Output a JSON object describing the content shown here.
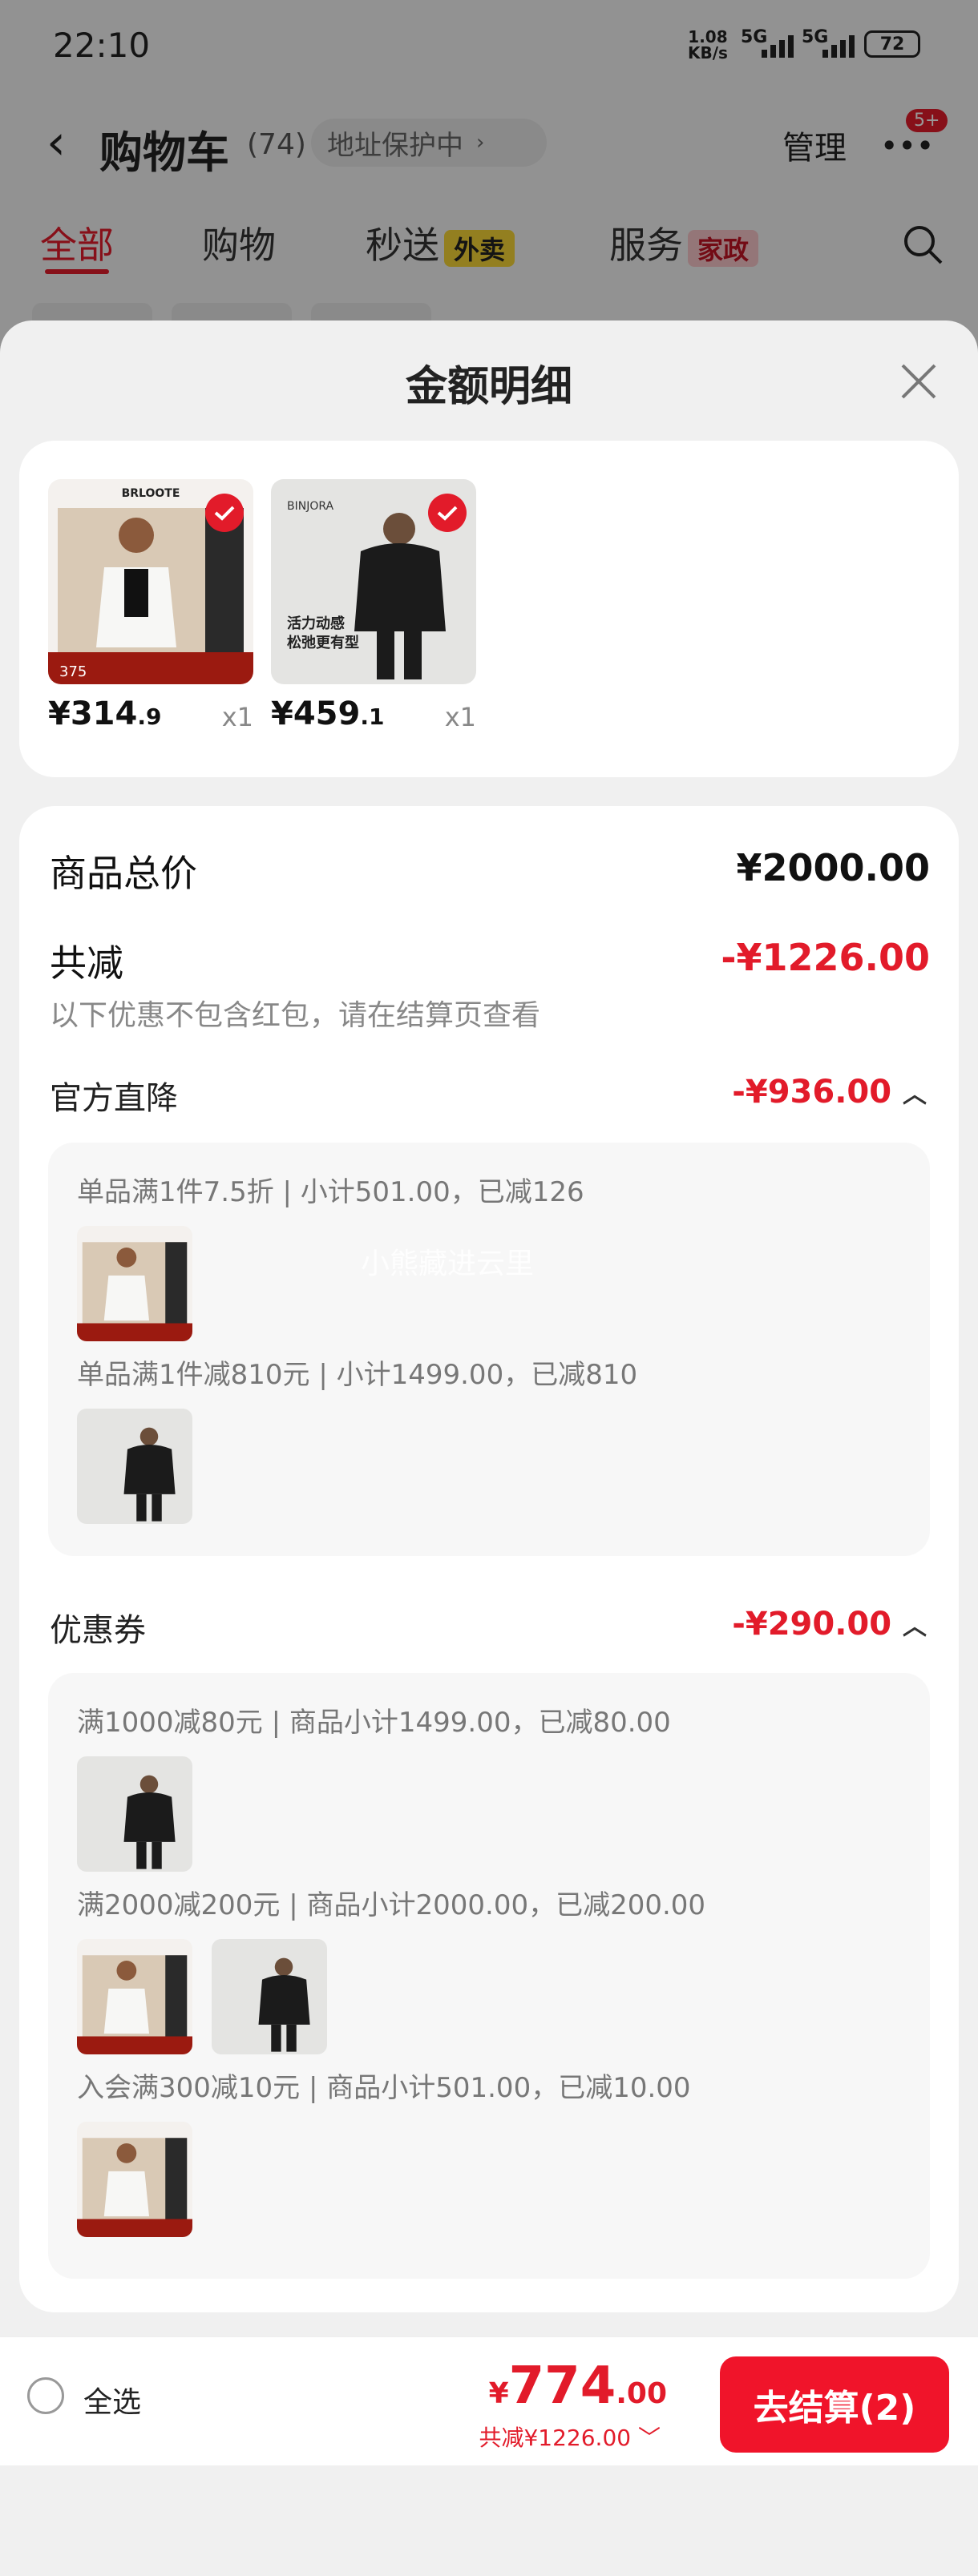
{
  "status_bar": {
    "time": "22:10",
    "net_speed": "1.08",
    "net_unit": "KB/s",
    "sig1": "5G",
    "sig2": "5G",
    "battery": "72"
  },
  "header": {
    "title": "购物车",
    "count": "(74)",
    "address": "地址保护中",
    "manage": "管理",
    "badge": "5+"
  },
  "tabs": [
    {
      "label": "全部"
    },
    {
      "label": "购物"
    },
    {
      "label": "秒送",
      "tag": "外卖"
    },
    {
      "label": "服务",
      "tag": "家政"
    }
  ],
  "sheet": {
    "title": "金额明细",
    "products": [
      {
        "brand": "BRLOOTE",
        "price_int": "¥314",
        "price_dec": ".9",
        "qty": "x1",
        "banner": "375"
      },
      {
        "brand": "BINJORA",
        "price_int": "¥459",
        "price_dec": ".1",
        "qty": "x1",
        "poster_lines": [
          "活力动感",
          "松弛更有型"
        ]
      }
    ],
    "total_label": "商品总价",
    "total_value": "¥2000.00",
    "discount_label": "共减",
    "discount_value": "-¥1226.00",
    "discount_note": "以下优惠不包含红包，请在结算页查看",
    "official": {
      "title": "官方直降",
      "value": "-¥936.00",
      "items": [
        "单品满1件7.5折 | 小计501.00，已减126",
        "单品满1件减810元 | 小计1499.00，已减810"
      ]
    },
    "coupon": {
      "title": "优惠券",
      "value": "-¥290.00",
      "items": [
        "满1000减80元 | 商品小计1499.00，已减80.00",
        "满2000减200元 | 商品小计2000.00，已减200.00",
        "入会满300减10元 | 商品小计501.00，已减10.00"
      ]
    },
    "watermark": "小熊藏进云里"
  },
  "bottom": {
    "select_all": "全选",
    "currency": "¥",
    "total_int": "774",
    "total_dec": ".00",
    "savings": "共减¥1226.00",
    "checkout": "去结算(2)"
  },
  "colors": {
    "accent": "#e21b2a",
    "checkout": "#f0142a"
  }
}
